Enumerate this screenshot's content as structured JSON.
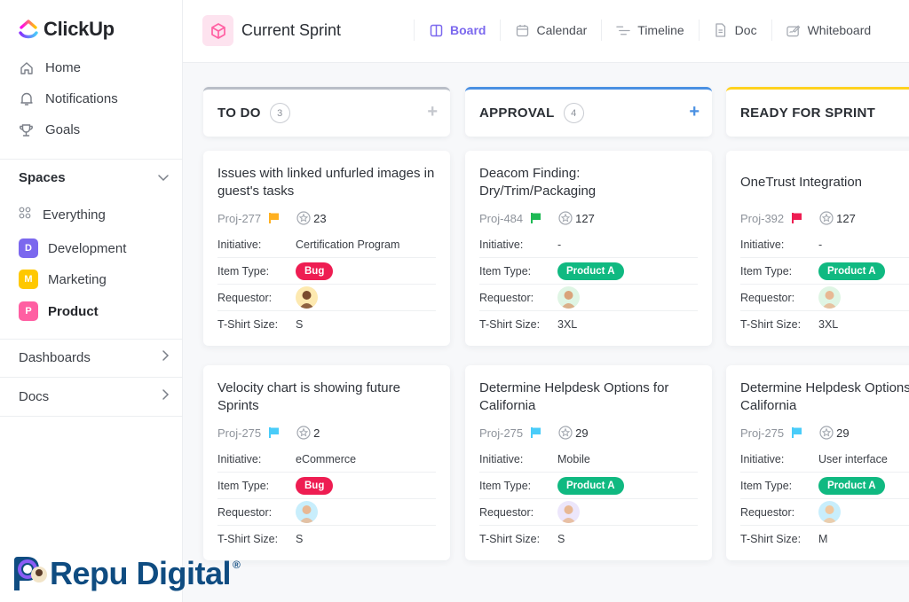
{
  "app": {
    "name": "ClickUp"
  },
  "sidebar": {
    "nav": [
      {
        "label": "Home",
        "icon": "home-icon"
      },
      {
        "label": "Notifications",
        "icon": "bell-icon"
      },
      {
        "label": "Goals",
        "icon": "trophy-icon"
      }
    ],
    "spaces_label": "Spaces",
    "everything_label": "Everything",
    "spaces": [
      {
        "initial": "D",
        "label": "Development",
        "color": "#7b68ee"
      },
      {
        "initial": "M",
        "label": "Marketing",
        "color": "#ffc800"
      },
      {
        "initial": "P",
        "label": "Product",
        "color": "#ff5fa2",
        "active": true
      }
    ],
    "links": [
      {
        "label": "Dashboards"
      },
      {
        "label": "Docs"
      }
    ]
  },
  "header": {
    "title": "Current Sprint",
    "views": [
      {
        "label": "Board",
        "icon": "board-icon",
        "active": true
      },
      {
        "label": "Calendar",
        "icon": "calendar-icon"
      },
      {
        "label": "Timeline",
        "icon": "timeline-icon"
      },
      {
        "label": "Doc",
        "icon": "doc-icon"
      },
      {
        "label": "Whiteboard",
        "icon": "whiteboard-icon"
      }
    ]
  },
  "field_labels": {
    "initiative": "Initiative:",
    "item_type": "Item Type:",
    "requestor": "Requestor:",
    "tshirt": "T-Shirt Size:"
  },
  "columns": [
    {
      "title": "TO DO",
      "count": "3",
      "accent": "#b9bec7",
      "add_color": "#c4c7cd",
      "cards": [
        {
          "title": "Issues with linked unfurled images in guest's tasks",
          "id": "Proj-277",
          "flag_color": "#ffb020",
          "points": "23",
          "initiative": "Certification Program",
          "item_type": "Bug",
          "item_type_color": "#ee1d52",
          "avatar_bg": "#fde9b0",
          "tshirt": "S"
        },
        {
          "title": "Velocity chart is showing future Sprints",
          "id": "Proj-275",
          "flag_color": "#49ccf9",
          "points": "2",
          "initiative": "eCommerce",
          "item_type": "Bug",
          "item_type_color": "#ee1d52",
          "avatar_bg": "#c8eefc",
          "tshirt": "S"
        }
      ]
    },
    {
      "title": "APPROVAL",
      "count": "4",
      "accent": "#4a90e2",
      "add_color": "#4a90e2",
      "cards": [
        {
          "title": "Deacom Finding: Dry/Trim/Packaging",
          "id": "Proj-484",
          "flag_color": "#1db954",
          "points": "127",
          "initiative": "-",
          "item_type": "Product A",
          "item_type_color": "#10b981",
          "avatar_bg": "#dff5e4",
          "tshirt": "3XL"
        },
        {
          "title": "Determine Helpdesk Options for California",
          "id": "Proj-275",
          "flag_color": "#49ccf9",
          "points": "29",
          "initiative": "Mobile",
          "item_type": "Product A",
          "item_type_color": "#10b981",
          "avatar_bg": "#ece6fb",
          "tshirt": "S"
        }
      ]
    },
    {
      "title": "READY FOR SPRINT",
      "count": "",
      "accent": "#ffd21f",
      "add_color": "",
      "cards": [
        {
          "title": "OneTrust Integration",
          "id": "Proj-392",
          "flag_color": "#ee1d52",
          "points": "127",
          "initiative": "-",
          "item_type": "Product A",
          "item_type_color": "#10b981",
          "avatar_bg": "#dff5e4",
          "tshirt": "3XL"
        },
        {
          "title": "Determine Helpdesk Options for California",
          "id": "Proj-275",
          "flag_color": "#49ccf9",
          "points": "29",
          "initiative": "User interface",
          "item_type": "Product A",
          "item_type_color": "#10b981",
          "avatar_bg": "#c8eefc",
          "tshirt": "M"
        }
      ]
    }
  ],
  "watermark": {
    "text": "Repu Digital",
    "reg": "®"
  }
}
